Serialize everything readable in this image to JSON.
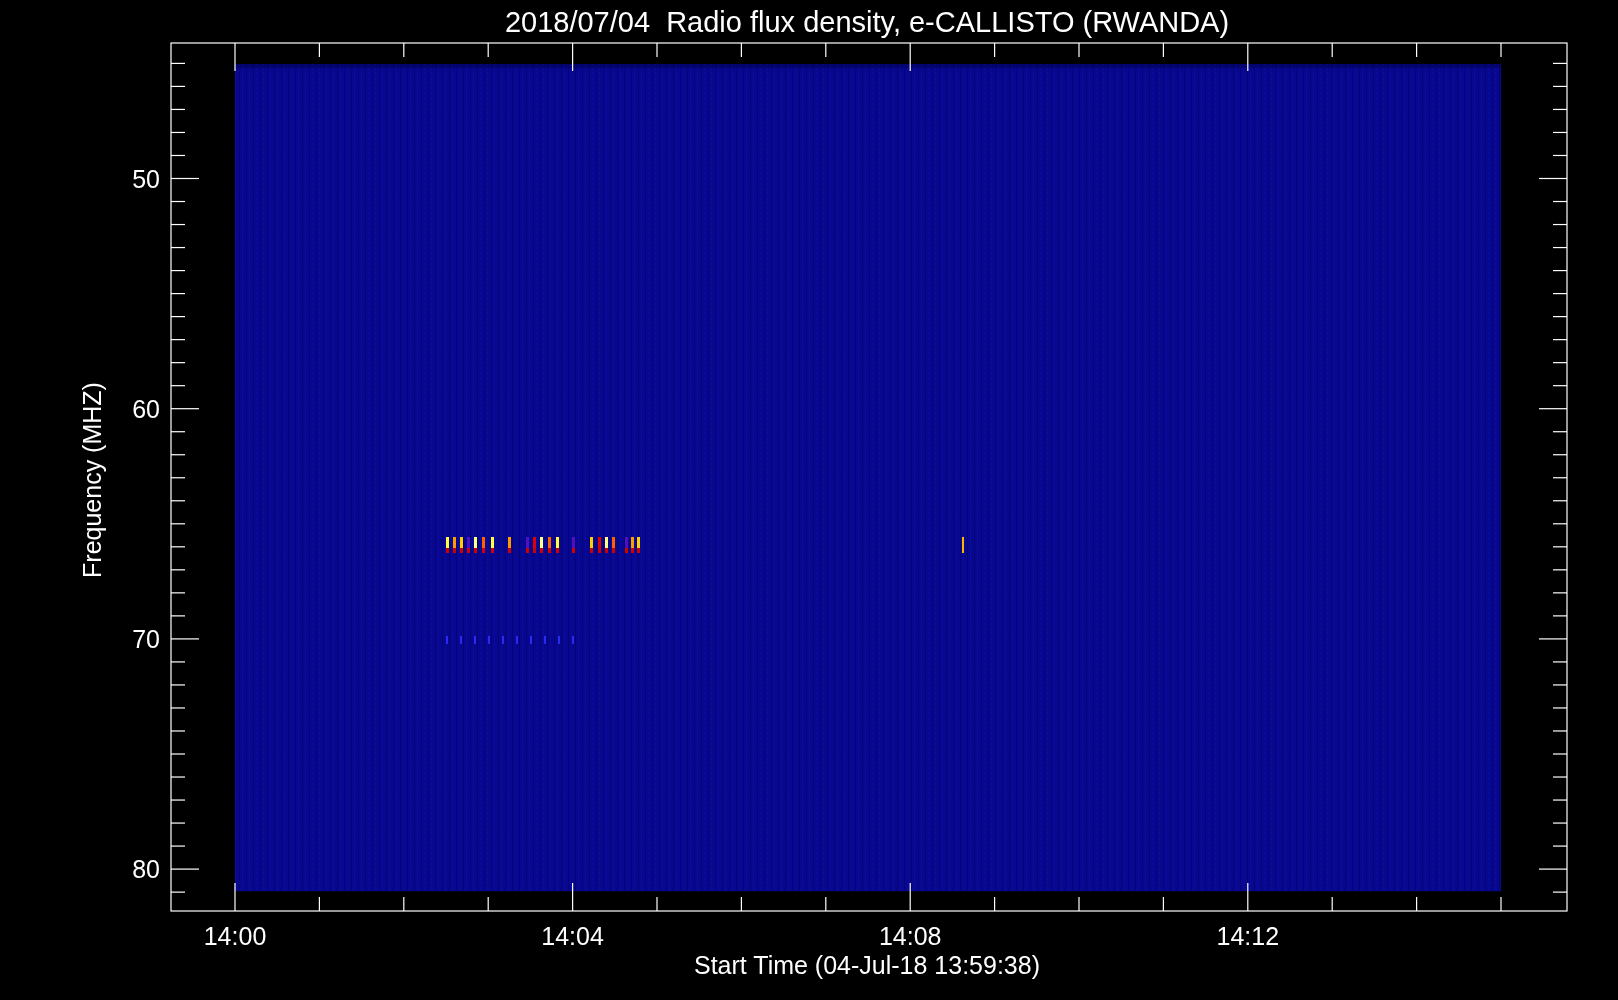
{
  "chart": {
    "title": "2018/07/04  Radio flux density, e-CALLISTO (RWANDA)",
    "x_axis": {
      "label": "Start Time (04-Jul-18 13:59:38)",
      "ticks": [
        "14:00",
        "14:04",
        "14:08",
        "14:12"
      ]
    },
    "y_axis": {
      "label": "Frequency (MHZ)",
      "ticks": [
        "50",
        "60",
        "70",
        "80"
      ]
    }
  }
}
